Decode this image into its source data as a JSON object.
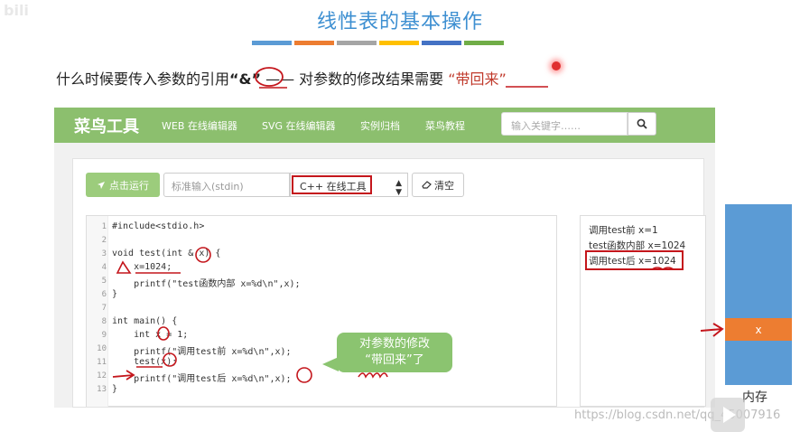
{
  "slide": {
    "watermark_tl": "bili",
    "title": "线性表的基本操作",
    "color_bars": [
      "#5b9bd5",
      "#ed7d31",
      "#a5a5a5",
      "#ffc000",
      "#4472c4",
      "#70ad47"
    ],
    "subtitle_pre": "什么时候要传入参数的引用",
    "subtitle_amp": "“&”",
    "subtitle_mid": " —— 对参数的修改结果需要 ",
    "subtitle_red": "“带回来”"
  },
  "navbar": {
    "brand": "菜鸟工具",
    "links": [
      "WEB 在线编辑器",
      "SVG 在线编辑器",
      "实例归档",
      "菜鸟教程"
    ],
    "search_placeholder": "输入关键字……",
    "search_icon": "search-icon"
  },
  "toolbar": {
    "run_label": "点击运行",
    "stdin_placeholder": "标准输入(stdin)",
    "language": "C++ 在线工具",
    "clear_label": "清空"
  },
  "editor": {
    "line_numbers": [
      "1",
      "2",
      "3",
      "4",
      "5",
      "6",
      "7",
      "8",
      "9",
      "10",
      "11",
      "12",
      "13"
    ],
    "lines": [
      "#include<stdio.h>",
      "",
      "void test(int & x) {",
      "    x=1024;",
      "    printf(\"test函数内部 x=%d\\n\",x);",
      "}",
      "",
      "int main() {",
      "    int x = 1;",
      "    printf(\"调用test前 x=%d\\n\",x);",
      "    test(x);",
      "    printf(\"调用test后 x=%d\\n\",x);",
      "}"
    ]
  },
  "output": {
    "lines": [
      "调用test前 x=1",
      "test函数内部 x=1024",
      "调用test后 x=1024"
    ]
  },
  "callout": {
    "line1": "对参数的修改",
    "line2": "“带回来”了"
  },
  "memory": {
    "cell_label": "x",
    "label": "内存"
  },
  "watermark": "https://blog.csdn.net/qq_45007916",
  "colors": {
    "accent_green": "#8cbf6e",
    "title_blue": "#3d8fd1",
    "annotation_red": "#c4161c"
  }
}
